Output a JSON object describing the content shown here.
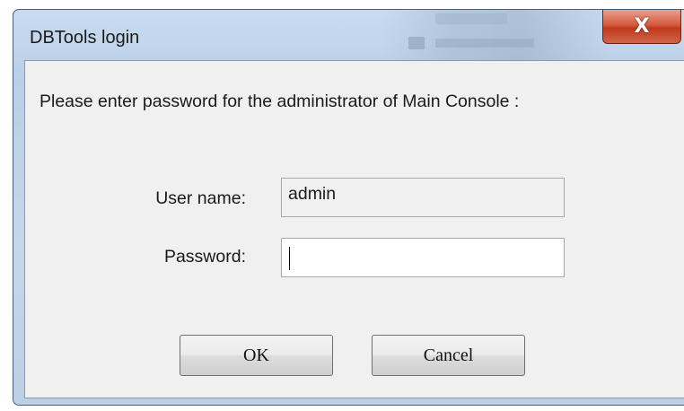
{
  "window": {
    "title": "DBTools login",
    "close_glyph": "X"
  },
  "dialog": {
    "prompt": "Please enter password for the administrator of Main Console :",
    "username_label": "User name:",
    "username_value": "admin",
    "password_label": "Password:",
    "password_value": "",
    "ok_label": "OK",
    "cancel_label": "Cancel"
  },
  "colors": {
    "close_button": "#c7442a",
    "client_background": "#f0f0f0",
    "frame": "#b9cfe8"
  },
  "icons": {
    "close": "close-icon"
  }
}
